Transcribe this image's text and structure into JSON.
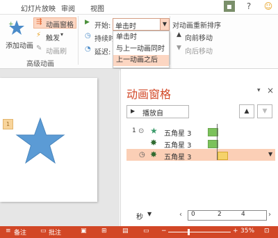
{
  "ribbon_tabs": [
    "幻灯片放映",
    "审阅",
    "视图"
  ],
  "title_icons": [
    "avatar-icon",
    "question-icon",
    "smiley-icon"
  ],
  "ribbon": {
    "add_animation": {
      "icon": "star-icon",
      "label": "添加动画"
    },
    "animation_pane": {
      "label": "动画窗格",
      "active": true
    },
    "trigger": {
      "label": "触发"
    },
    "animation_painter": {
      "label": "动画刷"
    },
    "group_label": "高级动画",
    "start_label": "开始:",
    "start_value": "单击时",
    "duration_label": "持续时",
    "delay_label": "延迟:",
    "reorder_title": "对动画重新排序",
    "move_earlier": "向前移动",
    "move_later": "向后移动",
    "start_options": [
      "单击时",
      "与上一动画同时",
      "上一动画之后"
    ],
    "selected_option": "上一动画之后"
  },
  "slide": {
    "shape": "five-point-star",
    "star_color": "#5b9bd5"
  },
  "pane": {
    "title": "动画窗格",
    "play_button": "播放自",
    "move_up_icon": "triangle-up-icon",
    "move_down_icon": "triangle-down-icon",
    "close_icon": "close-icon",
    "rows": [
      {
        "number": "1",
        "label": "五角星 3",
        "icon": "star-outline-icon",
        "start": "on-click",
        "bar_color": "#7bc25a"
      },
      {
        "number": "",
        "label": "五角星 3",
        "icon": "star-burst-icon",
        "start": "with-previous",
        "bar_color": "#7bc25a"
      },
      {
        "number": "",
        "label": "五角星 3",
        "icon": "star-burst-icon",
        "start": "after-previous",
        "bar_color": "#f5d26a",
        "selected": true
      }
    ],
    "timeline_unit": "秒",
    "timeline_ticks": [
      "0",
      "2",
      "4"
    ]
  },
  "status_bar": {
    "notes": "备注",
    "comments": "批注",
    "zoom": "35%"
  },
  "colors": {
    "accent": "#d24726",
    "highlight": "#fcd6c2"
  }
}
